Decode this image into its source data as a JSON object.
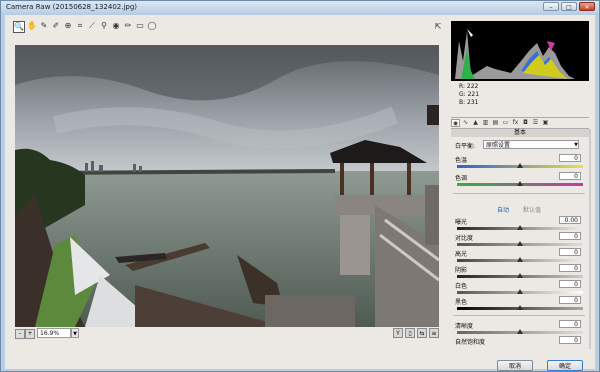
{
  "window": {
    "title": "Camera Raw (20150628_132402.jpg)",
    "controls": {
      "minimize": "–",
      "maximize": "□",
      "close": "✕"
    }
  },
  "toolbar": {
    "tools": [
      "zoom-icon",
      "hand-icon",
      "white-balance-icon",
      "color-sampler-icon",
      "target-adjust-icon",
      "crop-icon",
      "straighten-icon",
      "spot-removal-icon",
      "red-eye-icon",
      "adjustment-brush-icon",
      "graduated-filter-icon",
      "radial-filter-icon"
    ],
    "fullscreen": "fullscreen-icon"
  },
  "zoom": {
    "value": "16.9%",
    "minus": "–",
    "plus": "+"
  },
  "readout": {
    "r": "R:  222",
    "g": "G:  221",
    "b": "B:  231"
  },
  "panel": {
    "section": "基本",
    "wb_label": "白平衡:",
    "wb_value": "原照设置",
    "auto": "自动",
    "default": "默认值",
    "sliders": [
      {
        "label": "色温",
        "value": "0",
        "pos": 0.5
      },
      {
        "label": "色调",
        "value": "0",
        "pos": 0.5
      },
      {
        "label": "曝光",
        "value": "0.00",
        "pos": 0.5
      },
      {
        "label": "对比度",
        "value": "0",
        "pos": 0.5
      },
      {
        "label": "高光",
        "value": "0",
        "pos": 0.5
      },
      {
        "label": "阴影",
        "value": "0",
        "pos": 0.5
      },
      {
        "label": "白色",
        "value": "0",
        "pos": 0.5
      },
      {
        "label": "黑色",
        "value": "0",
        "pos": 0.5
      },
      {
        "label": "清晰度",
        "value": "0",
        "pos": 0.5
      },
      {
        "label": "自然饱和度",
        "value": "0",
        "pos": 0.5
      }
    ]
  },
  "buttons": {
    "cancel": "取消",
    "ok": "确定"
  },
  "colors": {
    "accent": "#1a5fb4",
    "window_frame": "#b9cde2",
    "histogram_bg": "#000000"
  }
}
